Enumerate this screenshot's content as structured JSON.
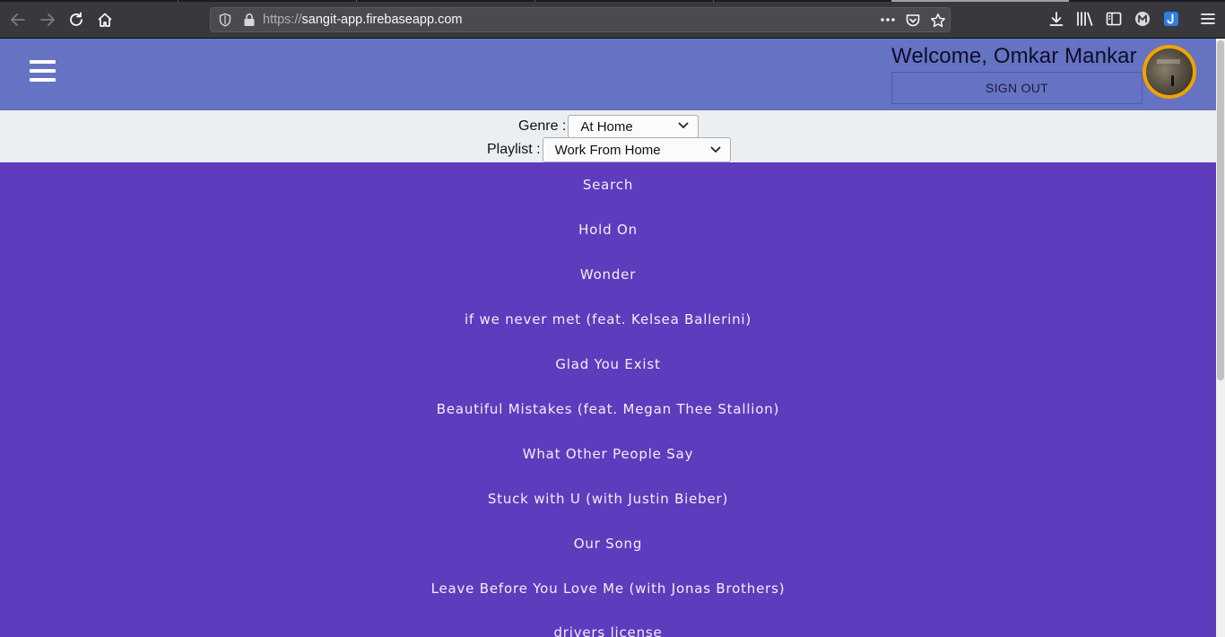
{
  "browser": {
    "url_prefix": "https://",
    "url_host": "sangit-app.firebaseapp.com"
  },
  "header": {
    "welcome": "Welcome, Omkar Mankar",
    "signout_label": "SIGN OUT",
    "menu_icon": "hamburger-menu-icon",
    "colors": {
      "header_bg": "#6673c2",
      "avatar_ring": "#f2a100"
    }
  },
  "filters": {
    "genre_label": "Genre :",
    "genre_value": "At Home",
    "playlist_label": "Playlist :",
    "playlist_value": "Work From Home"
  },
  "songs": {
    "background": "#5f3bbd",
    "items": [
      "Search",
      "Hold On",
      "Wonder",
      "if we never met (feat. Kelsea Ballerini)",
      "Glad You Exist",
      "Beautiful Mistakes (feat. Megan Thee Stallion)",
      "What Other People Say",
      "Stuck with U (with Justin Bieber)",
      "Our Song",
      "Leave Before You Love Me (with Jonas Brothers)",
      "drivers license"
    ]
  }
}
